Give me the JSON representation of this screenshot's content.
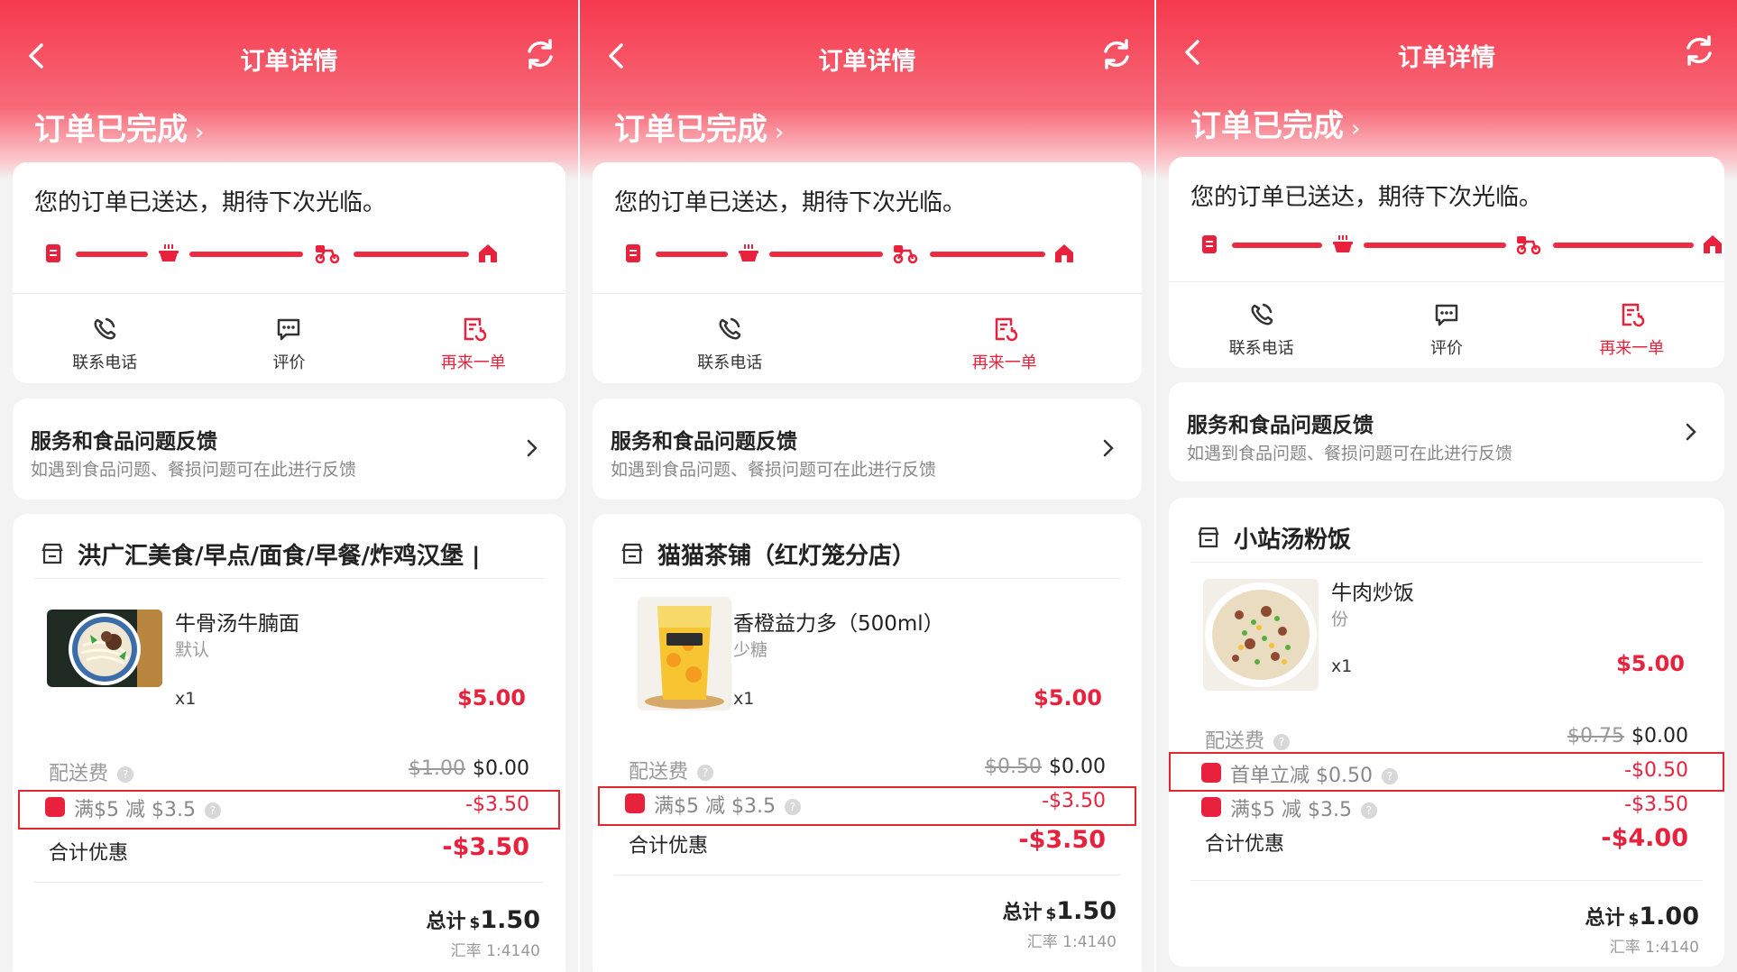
{
  "panels": [
    {
      "page_title": "订单详情",
      "status_title": "订单已完成",
      "delivered_msg": "您的订单已送达，期待下次光临。",
      "actions": [
        "联系电话",
        "评价",
        "再来一单"
      ],
      "feedback": {
        "title": "服务和食品问题反馈",
        "subtitle": "如遇到食品问题、餐损问题可在此进行反馈"
      },
      "shop_name": "洪广汇美食/早点/面食/早餐/炸鸡汉堡 |",
      "item": {
        "name": "牛骨汤牛腩面",
        "spec": "默认",
        "qty": "x1",
        "price": "$5.00"
      },
      "delivery_fee": {
        "label": "配送费",
        "original": "$1.00",
        "current": "$0.00"
      },
      "discounts": [
        {
          "label": "满$5 减 $3.5",
          "value": "-$3.50"
        }
      ],
      "total_discount": {
        "label": "合计优惠",
        "value": "-$3.50"
      },
      "grand_total": {
        "label": "总计",
        "currency": "$",
        "value": "1.50"
      },
      "exchange_rate": "汇率 1:4140"
    },
    {
      "page_title": "订单详情",
      "status_title": "订单已完成",
      "delivered_msg": "您的订单已送达，期待下次光临。",
      "actions": [
        "联系电话",
        "再来一单"
      ],
      "feedback": {
        "title": "服务和食品问题反馈",
        "subtitle": "如遇到食品问题、餐损问题可在此进行反馈"
      },
      "shop_name": "猫猫茶铺（红灯笼分店）",
      "item": {
        "name": "香橙益力多（500ml）",
        "spec": "少糖",
        "qty": "x1",
        "price": "$5.00"
      },
      "delivery_fee": {
        "label": "配送费",
        "original": "$0.50",
        "current": "$0.00"
      },
      "discounts": [
        {
          "label": "满$5 减 $3.5",
          "value": "-$3.50"
        }
      ],
      "total_discount": {
        "label": "合计优惠",
        "value": "-$3.50"
      },
      "grand_total": {
        "label": "总计",
        "currency": "$",
        "value": "1.50"
      },
      "exchange_rate": "汇率 1:4140"
    },
    {
      "page_title": "订单详情",
      "status_title": "订单已完成",
      "delivered_msg": "您的订单已送达，期待下次光临。",
      "actions": [
        "联系电话",
        "评价",
        "再来一单"
      ],
      "feedback": {
        "title": "服务和食品问题反馈",
        "subtitle": "如遇到食品问题、餐损问题可在此进行反馈"
      },
      "shop_name": "小站汤粉饭",
      "item": {
        "name": "牛肉炒饭",
        "spec": "份",
        "qty": "x1",
        "price": "$5.00"
      },
      "delivery_fee": {
        "label": "配送费",
        "original": "$0.75",
        "current": "$0.00"
      },
      "discounts": [
        {
          "label": "首单立减 $0.50",
          "value": "-$0.50"
        },
        {
          "label": "满$5 减 $3.5",
          "value": "-$3.50"
        }
      ],
      "total_discount": {
        "label": "合计优惠",
        "value": "-$4.00"
      },
      "grand_total": {
        "label": "总计",
        "currency": "$",
        "value": "1.00"
      },
      "exchange_rate": "汇率 1:4140"
    }
  ],
  "colors": {
    "brand_red": "#e8213c",
    "header_red": "#f5394e",
    "highlight_box": "#e3252e"
  }
}
